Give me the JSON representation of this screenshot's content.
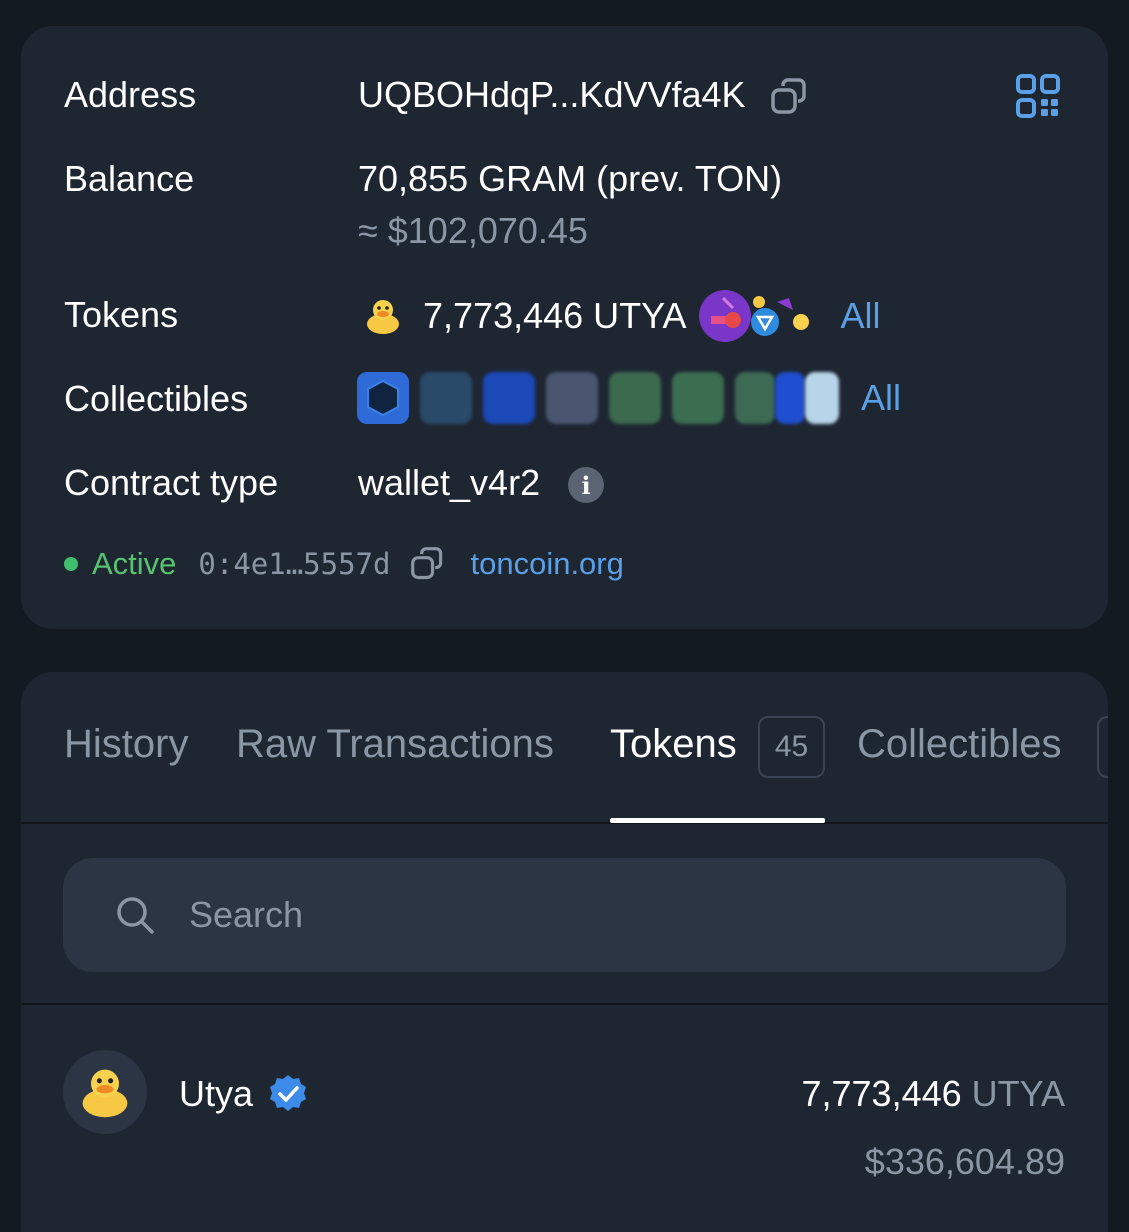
{
  "info": {
    "address_label": "Address",
    "address_value": "UQBOHdqP...KdVVfa4K",
    "balance_label": "Balance",
    "balance_value": "70,855 GRAM (prev. TON)",
    "balance_usd": "≈ $102,070.45",
    "tokens_label": "Tokens",
    "tokens_value": "7,773,446 UTYA",
    "tokens_all": "All",
    "collectibles_label": "Collectibles",
    "collectibles_all": "All",
    "contract_label": "Contract type",
    "contract_value": "wallet_v4r2",
    "status": "Active",
    "raw_address": "0:4e1…5557d",
    "link": "toncoin.org"
  },
  "tabs": [
    {
      "label": "History"
    },
    {
      "label": "Raw Transactions"
    },
    {
      "label": "Tokens",
      "badge": "45"
    },
    {
      "label": "Collectibles"
    }
  ],
  "search": {
    "placeholder": "Search"
  },
  "token_list": [
    {
      "name": "Utya",
      "amount": "7,773,446",
      "symbol": "UTYA",
      "usd": "$336,604.89"
    }
  ],
  "colors": {
    "background": "#141a22",
    "card": "#1e2632",
    "accent": "#5aa0e6",
    "active_green": "#56c36e",
    "muted": "#8b96a5"
  }
}
